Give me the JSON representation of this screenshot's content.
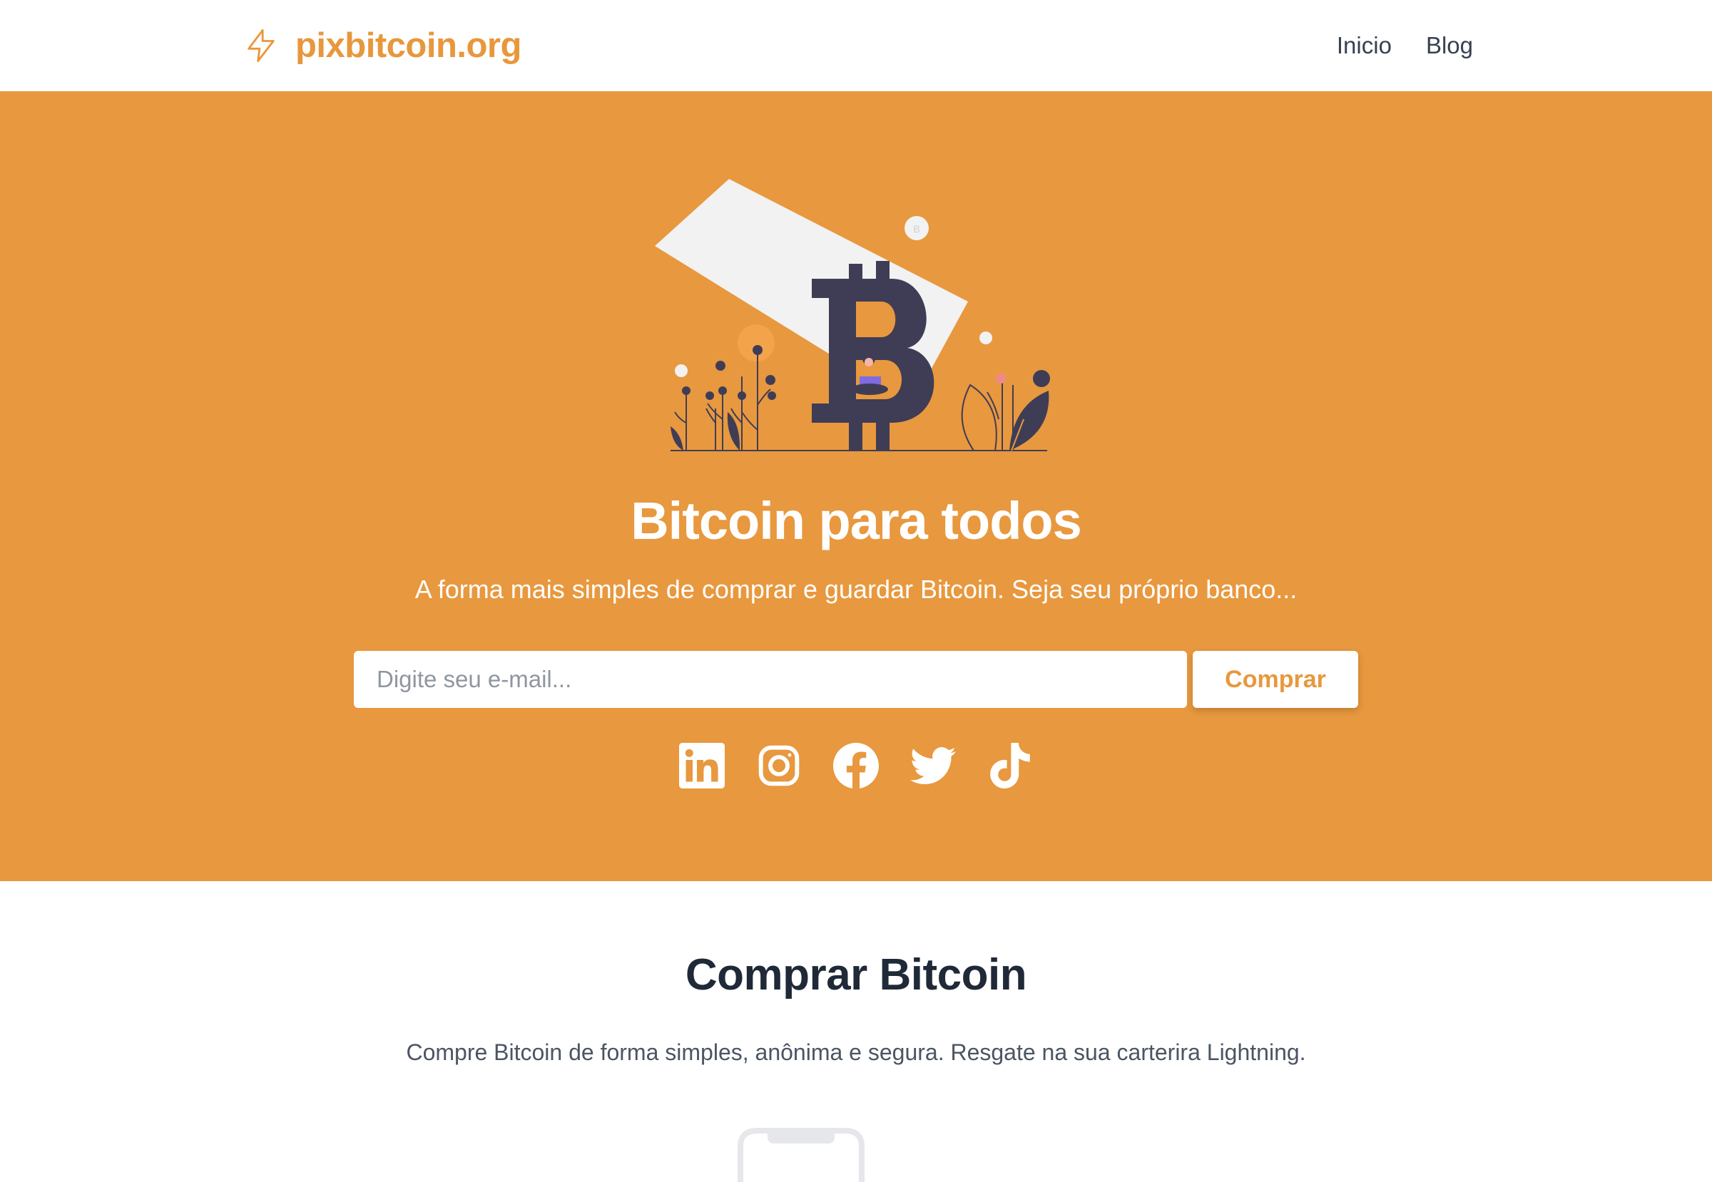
{
  "navbar": {
    "brand_name": "pixbitcoin.org",
    "brand_icon": "lightning-bolt-icon",
    "links": [
      {
        "label": "Inicio"
      },
      {
        "label": "Blog"
      }
    ]
  },
  "hero": {
    "illustration": "bitcoin-illustration",
    "title": "Bitcoin para todos",
    "subtitle": "A forma mais simples de comprar e guardar Bitcoin. Seja seu próprio banco...",
    "email_placeholder": "Digite seu e-mail...",
    "email_value": "",
    "buy_label": "Comprar",
    "social": [
      {
        "icon": "linkedin-icon"
      },
      {
        "icon": "instagram-icon"
      },
      {
        "icon": "facebook-icon"
      },
      {
        "icon": "twitter-icon"
      },
      {
        "icon": "tiktok-icon"
      }
    ]
  },
  "section": {
    "title": "Comprar Bitcoin",
    "text": "Compre Bitcoin de forma simples, anônima e segura. Resgate na sua carterira Lightning."
  },
  "colors": {
    "accent": "#e8983e",
    "brand_text": "#e8973c",
    "heading_dark": "#1f2937",
    "illustration_dark": "#3f3d56"
  }
}
